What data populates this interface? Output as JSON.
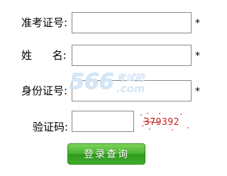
{
  "form": {
    "exam_id_label": "准考证号:",
    "name_label": "姓      名:",
    "id_card_label": "身份证号:",
    "captcha_label": "验证码:",
    "required_mark": "*",
    "exam_id_value": "",
    "name_value": "",
    "id_card_value": "",
    "captcha_value": "",
    "captcha_text": "379392",
    "submit_label": "登录查询"
  },
  "watermark": {
    "number": "566",
    "cn_text": "考试吧",
    "domain": ".com"
  },
  "colors": {
    "watermark": "#cfe3f5",
    "captcha_text": "#c81e1e",
    "captcha_noise": "#e98a8a",
    "button": "#45b12e"
  }
}
